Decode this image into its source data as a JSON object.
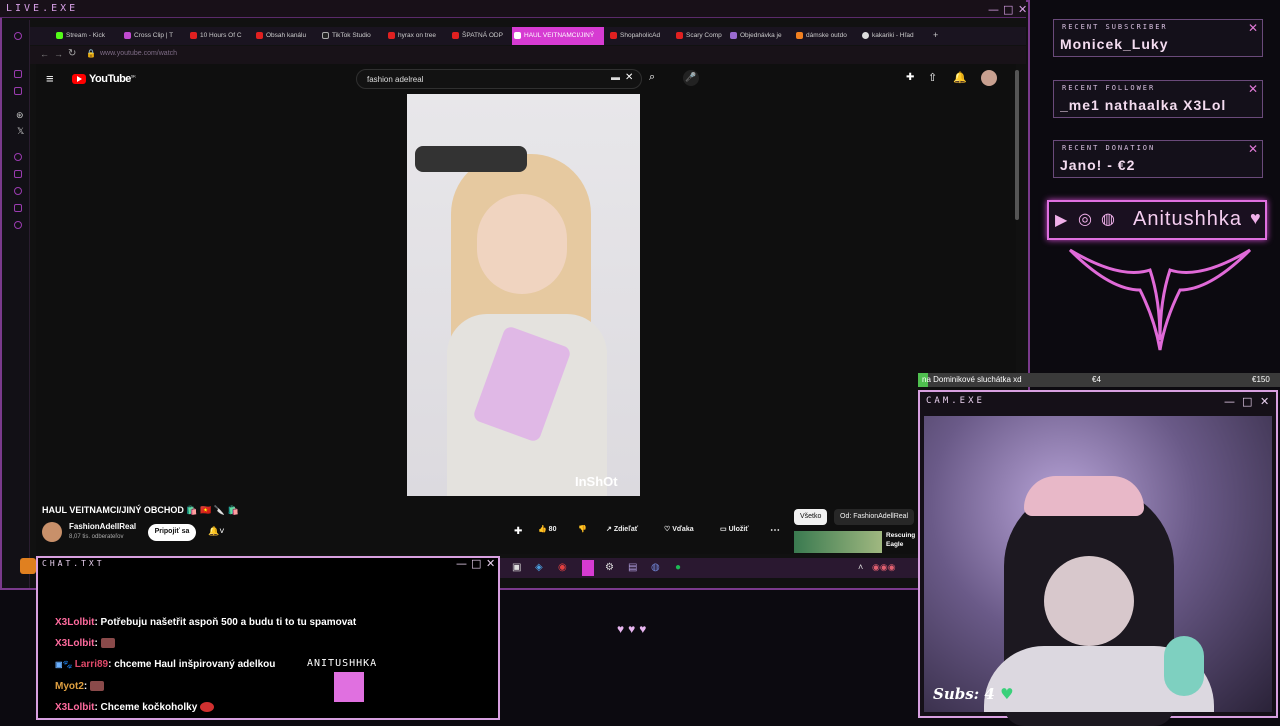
{
  "outer_window": {
    "title": "LIVE.EXE",
    "controls": [
      "—",
      "□",
      "✕"
    ]
  },
  "browser": {
    "tabs": [
      {
        "label": "Stream - Kick"
      },
      {
        "label": "Cross Clip | T"
      },
      {
        "label": "10 Hours Of C"
      },
      {
        "label": "Obsah kanálu"
      },
      {
        "label": "TikTok Studio"
      },
      {
        "label": "hyrax on tree"
      },
      {
        "label": "ŠPATNÁ ODP"
      },
      {
        "label": "HAUL VEITNAMCI/JINÝ",
        "active": true
      },
      {
        "label": "ShopaholicAd"
      },
      {
        "label": "Scary Comp"
      },
      {
        "label": "Objednávka je"
      },
      {
        "label": "dámske outdo"
      },
      {
        "label": "kakariki - Hľad"
      }
    ],
    "url": "www.youtube.com/watch"
  },
  "youtube": {
    "logo": "YouTube",
    "logo_region": "SK",
    "search_query": "fashion adelreal",
    "video_watermark": "InShOt",
    "video_title": "HAUL VEITNAMCI/JINÝ OBCHOD 🛍️ 🇻🇳 🔪 🛍️",
    "channel_name": "FashionAdellReal",
    "channel_subs": "8,07 tis. odberateľov",
    "join_label": "Pripojiť sa",
    "like_count": "80",
    "share_label": "Zdieľať",
    "thanks_label": "Vďaka",
    "save_label": "Uložiť",
    "chip_all": "Všetko",
    "chip_from": "Od: FashionAdellReal",
    "related_title": "Rescuing Eagle"
  },
  "panels": {
    "recent_subscriber": {
      "title": "RECENT SUBSCRIBER",
      "value": "Monicek_Luky"
    },
    "recent_follower": {
      "title": "RECENT FOLLOWER",
      "value": "_me1    nathaalka    X3Lol"
    },
    "recent_donation": {
      "title": "RECENT DONATION",
      "value": "Jano! - €2"
    }
  },
  "social": {
    "name": "Anitushhka"
  },
  "goal": {
    "text": "na Dominikové sluchátka xd",
    "current": "€4",
    "target": "€150",
    "progress": 0.027
  },
  "cam": {
    "title": "CAM.EXE",
    "subs_label": "Subs: 4"
  },
  "chat": {
    "title": "CHAT.TXT",
    "messages": [
      {
        "user": "X3Lolbit",
        "text": ": Potřebuju našetřit aspoň 500 a budu ti to tu spamovat"
      },
      {
        "user": "X3Lolbit",
        "text": ":"
      },
      {
        "user": "Larri89",
        "text": ": chceme Haul inšpirovaný adelkou"
      },
      {
        "user": "Myot2",
        "text": ":"
      },
      {
        "user": "X3Lolbit",
        "text": ": Chceme kočkoholky"
      }
    ],
    "watermark": "ANITUSHHKA"
  },
  "hearts": "♥♥♥",
  "colors": {
    "accent": "#d63bd2",
    "frame": "#d8a0e0",
    "goal_fill": "#4fbf4f",
    "yt_red": "#ff0000"
  }
}
